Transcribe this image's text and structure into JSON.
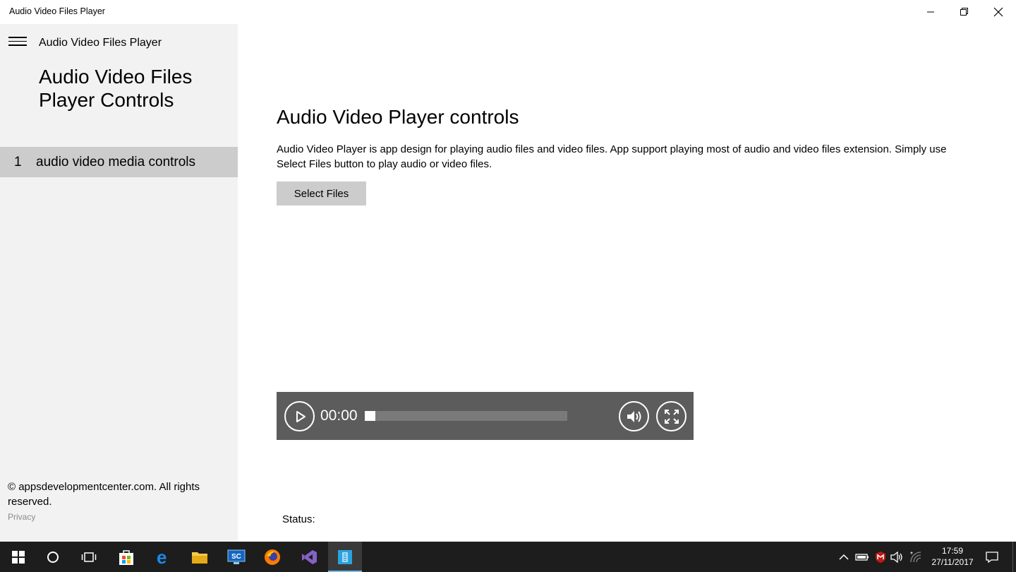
{
  "window": {
    "title": "Audio Video Files Player"
  },
  "sidebar": {
    "app_name": "Audio Video Files Player",
    "heading": "Audio Video Files Player Controls",
    "items": [
      {
        "number": "1",
        "label": "audio video media controls",
        "selected": true
      }
    ],
    "copyright": "© appsdevelopmentcenter.com. All rights reserved.",
    "privacy": "Privacy"
  },
  "main": {
    "title": "Audio Video Player controls",
    "description": "Audio Video Player is app design for playing audio files and video files. App support playing most of audio and video files extension. Simply use Select Files button to play audio or video files.",
    "select_button": "Select Files",
    "status_label": "Status:"
  },
  "media_controls": {
    "time": "00:00",
    "progress": 0,
    "icons": [
      "play-icon",
      "volume-icon",
      "fullscreen-icon"
    ]
  },
  "taskbar": {
    "apps": [
      "start-icon",
      "cortana-icon",
      "task-view-icon",
      "store-icon",
      "edge-icon",
      "file-explorer-icon",
      "sc-app-icon",
      "firefox-icon",
      "visual-studio-icon",
      "audio-video-player-app-icon"
    ],
    "clock_time": "17:59",
    "clock_date": "27/11/2017"
  },
  "colors": {
    "sidebar_bg": "#f2f2f2",
    "selected_item_bg": "#cccccc",
    "media_bar_bg": "#5c5c5c",
    "taskbar_bg": "#1d1d1d"
  }
}
